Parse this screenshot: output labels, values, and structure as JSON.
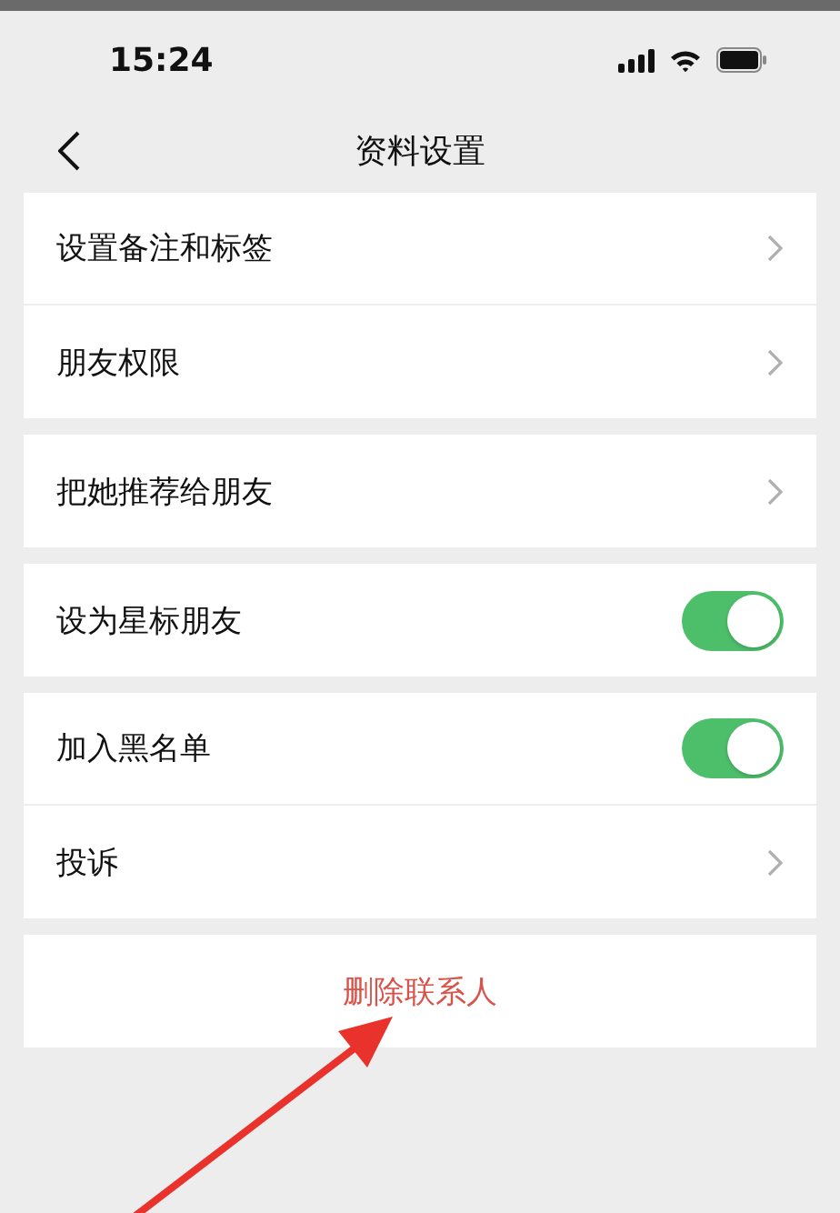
{
  "status_bar": {
    "time": "15:24"
  },
  "nav": {
    "title": "资料设置"
  },
  "groups": [
    {
      "rows": [
        {
          "kind": "link",
          "label": "设置备注和标签"
        },
        {
          "kind": "link",
          "label": "朋友权限"
        }
      ]
    },
    {
      "rows": [
        {
          "kind": "link",
          "label": "把她推荐给朋友"
        }
      ]
    },
    {
      "rows": [
        {
          "kind": "toggle",
          "label": "设为星标朋友",
          "on": true
        }
      ]
    },
    {
      "rows": [
        {
          "kind": "toggle",
          "label": "加入黑名单",
          "on": true
        },
        {
          "kind": "link",
          "label": "投诉"
        }
      ]
    },
    {
      "rows": [
        {
          "kind": "danger",
          "label": "删除联系人"
        }
      ]
    }
  ]
}
